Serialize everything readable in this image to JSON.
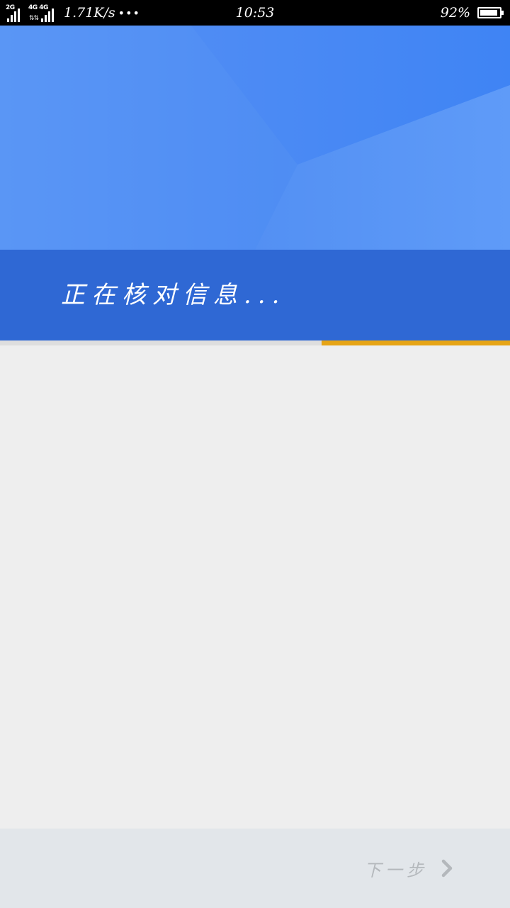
{
  "status_bar": {
    "sim1_network": "2G",
    "sim2_network": "4G 4G",
    "data_speed": "1.71K/s",
    "more_indicator": "•••",
    "time": "10:53",
    "battery_percent": "92%",
    "battery_level": 0.92
  },
  "header": {
    "status_text": "正在核对信息...",
    "progress": 0.37,
    "colors": {
      "banner_blue": "#4a89f2",
      "band_blue": "#2f68d4",
      "progress_accent": "#e6a415"
    }
  },
  "footer": {
    "next_label": "下一步",
    "next_icon": "chevron-right-icon"
  }
}
